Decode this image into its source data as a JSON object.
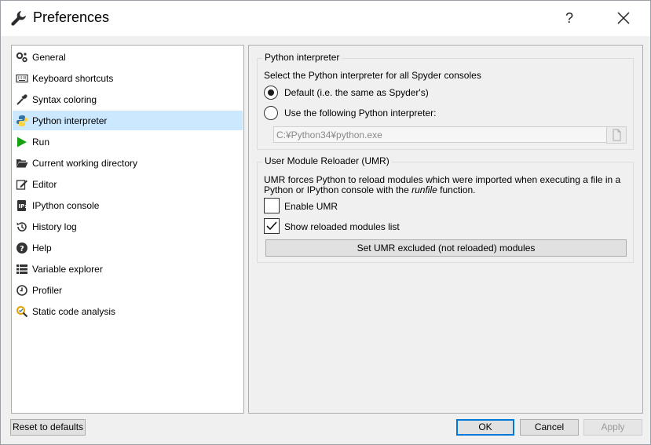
{
  "window": {
    "title": "Preferences",
    "help_label": "?"
  },
  "sidebar": {
    "items": [
      {
        "label": "General",
        "icon": "gears-icon"
      },
      {
        "label": "Keyboard shortcuts",
        "icon": "keyboard-icon"
      },
      {
        "label": "Syntax coloring",
        "icon": "eyedropper-icon"
      },
      {
        "label": "Python interpreter",
        "icon": "python-icon",
        "selected": true
      },
      {
        "label": "Run",
        "icon": "play-icon"
      },
      {
        "label": "Current working directory",
        "icon": "folder-icon"
      },
      {
        "label": "Editor",
        "icon": "edit-icon"
      },
      {
        "label": "IPython console",
        "icon": "ipython-icon"
      },
      {
        "label": "History log",
        "icon": "history-icon"
      },
      {
        "label": "Help",
        "icon": "question-icon"
      },
      {
        "label": "Variable explorer",
        "icon": "table-icon"
      },
      {
        "label": "Profiler",
        "icon": "clock-icon"
      },
      {
        "label": "Static code analysis",
        "icon": "analysis-icon"
      }
    ]
  },
  "interpreter": {
    "group_title": "Python interpreter",
    "description": "Select the Python interpreter for all Spyder consoles",
    "default_option": "Default (i.e. the same as Spyder's)",
    "custom_option": "Use the following Python interpreter:",
    "selected": "default",
    "path_value": "C:¥Python34¥python.exe"
  },
  "umr": {
    "group_title": "User Module Reloader (UMR)",
    "description_line1": "UMR forces Python to reload modules which were imported when executing a file in a",
    "description_line2_prefix": "Python or IPython console with the ",
    "description_line2_italic": "runfile",
    "description_line2_suffix": " function.",
    "enable_label": "Enable UMR",
    "enable_checked": false,
    "show_label": "Show reloaded modules list",
    "show_checked": true,
    "set_button": "Set UMR excluded (not reloaded) modules"
  },
  "footer": {
    "reset_label": "Reset to defaults",
    "ok_label": "OK",
    "cancel_label": "Cancel",
    "apply_label": "Apply"
  },
  "colors": {
    "selection": "#cce8ff",
    "default_button_border": "#0078d7",
    "python_blue": "#3572a5",
    "python_yellow": "#ffd43b",
    "run_green": "#14a010"
  }
}
